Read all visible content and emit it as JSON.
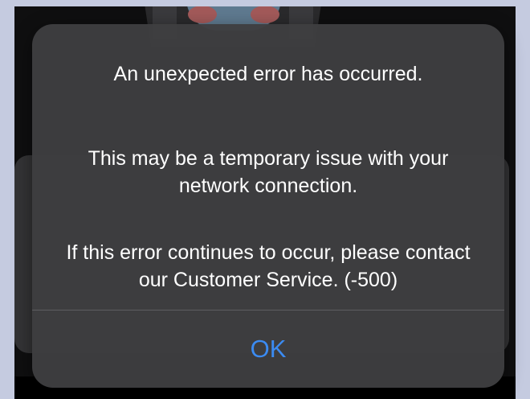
{
  "alert": {
    "title": "An unexpected error has occurred.",
    "message_line_1": "This may be a temporary issue with your network connection.",
    "message_line_2": "If this error continues to occur, please contact our Customer Service. (-500)",
    "ok_label": "OK"
  },
  "colors": {
    "accent": "#3b8bf2",
    "alert_background": "#3e3e40",
    "text": "#ffffff"
  },
  "icons": {
    "background_art": "mascot-illustration"
  }
}
